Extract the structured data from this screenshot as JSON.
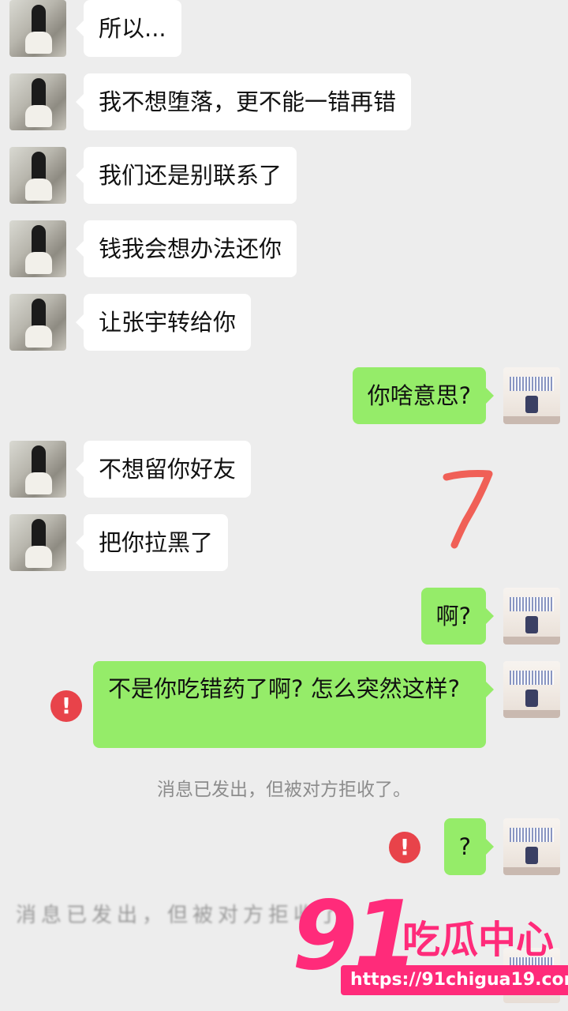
{
  "messages": [
    {
      "from": "her",
      "text": "所以..."
    },
    {
      "from": "her",
      "text": "我不想堕落，更不能一错再错"
    },
    {
      "from": "her",
      "text": "我们还是别联系了"
    },
    {
      "from": "her",
      "text": "钱我会想办法还你"
    },
    {
      "from": "her",
      "text": "让张宇转给你"
    },
    {
      "from": "me",
      "text": "你啥意思?"
    },
    {
      "from": "her",
      "text": "不想留你好友"
    },
    {
      "from": "her",
      "text": "把你拉黑了"
    },
    {
      "from": "me",
      "text": "啊?"
    },
    {
      "from": "me",
      "text": "不是你吃错药了啊? 怎么突然这样?",
      "failed": true
    },
    {
      "from": "me",
      "text": "?",
      "failed": true
    }
  ],
  "system_notice": "消息已发出，但被对方拒收了。",
  "blurred_notice": "消息已发出，但被对方拒收了。",
  "error_icon": "!",
  "annotation": "7",
  "watermark": {
    "brand_number": "91",
    "brand_name": "吃瓜中心",
    "url": "https://91chigua19.com"
  },
  "colors": {
    "background": "#ededed",
    "incoming_bubble": "#ffffff",
    "outgoing_bubble": "#95ec69",
    "error": "#e8434a",
    "watermark": "#ff2b7a"
  }
}
